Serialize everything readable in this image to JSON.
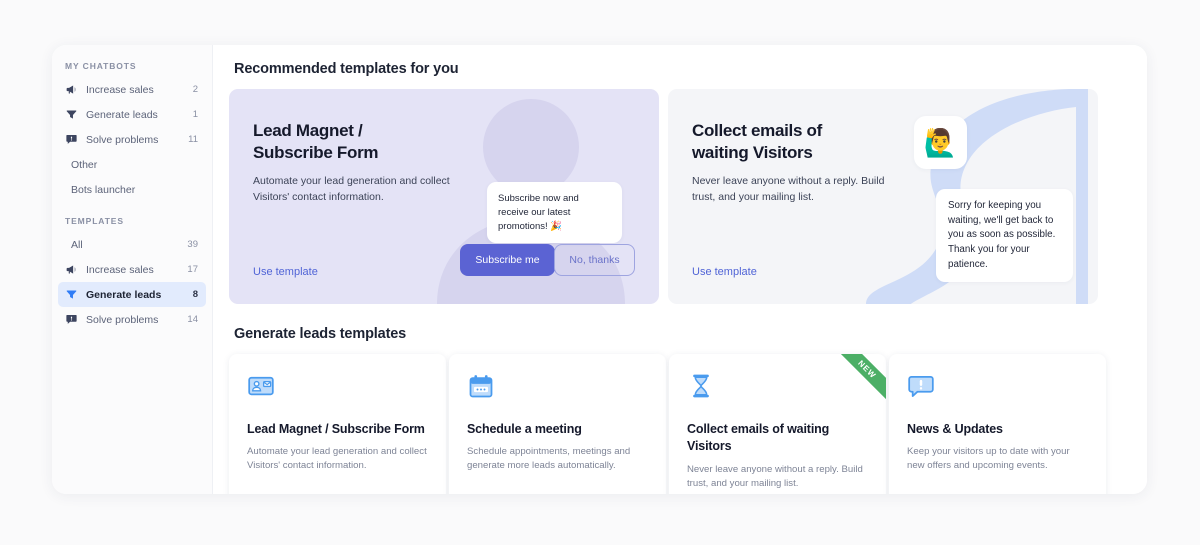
{
  "sidebar": {
    "sections": [
      {
        "title": "MY CHATBOTS",
        "items": [
          {
            "icon": "megaphone-icon",
            "label": "Increase sales",
            "count": "2",
            "active": false
          },
          {
            "icon": "funnel-icon",
            "label": "Generate leads",
            "count": "1",
            "active": false
          },
          {
            "icon": "chat-icon",
            "label": "Solve problems",
            "count": "11",
            "active": false
          },
          {
            "icon": "",
            "label": "Other",
            "count": "",
            "active": false
          },
          {
            "icon": "",
            "label": "Bots launcher",
            "count": "",
            "active": false
          }
        ]
      },
      {
        "title": "TEMPLATES",
        "items": [
          {
            "icon": "",
            "label": "All",
            "count": "39",
            "active": false
          },
          {
            "icon": "megaphone-icon",
            "label": "Increase sales",
            "count": "17",
            "active": false
          },
          {
            "icon": "funnel-icon",
            "label": "Generate leads",
            "count": "8",
            "active": true
          },
          {
            "icon": "chat-icon",
            "label": "Solve problems",
            "count": "14",
            "active": false
          }
        ]
      }
    ]
  },
  "recommended": {
    "heading": "Recommended templates for you",
    "cards": [
      {
        "title": "Lead Magnet /\nSubscribe Form",
        "description": "Automate your lead generation and collect Visitors' contact information.",
        "link": "Use template",
        "bubble": "Subscribe now and receive our latest promotions! 🎉",
        "primary_button": "Subscribe me",
        "secondary_button": "No, thanks"
      },
      {
        "title": "Collect emails of\nwaiting Visitors",
        "description": "Never leave anyone without a reply. Build trust, and your mailing list.",
        "link": "Use template",
        "avatar_emoji": "🙋‍♂️",
        "bubble": "Sorry for keeping you waiting, we'll get back to you as soon as possible. Thank you for your patience."
      }
    ]
  },
  "templates": {
    "heading": "Generate leads templates",
    "cards": [
      {
        "icon": "contact-card-icon",
        "title": "Lead Magnet / Subscribe Form",
        "description": "Automate your lead generation and collect Visitors' contact information.",
        "badge": ""
      },
      {
        "icon": "calendar-icon",
        "title": "Schedule a meeting",
        "description": "Schedule appointments, meetings and generate more leads automatically.",
        "badge": ""
      },
      {
        "icon": "hourglass-icon",
        "title": "Collect emails of waiting Visitors",
        "description": "Never leave anyone without a reply. Build trust, and your mailing list.",
        "badge": "NEW"
      },
      {
        "icon": "alert-chat-icon",
        "title": "News & Updates",
        "description": "Keep your visitors up to date with your new offers and upcoming events.",
        "badge": ""
      }
    ]
  },
  "colors": {
    "accent": "#5b63d3",
    "link": "#5064d6",
    "active_item_bg": "#e2ebfd",
    "card_lavender": "#e4e3f6",
    "card_grey": "#f4f5f8",
    "icon_blue": "#5aa9f2",
    "badge_green": "#4caf66"
  }
}
